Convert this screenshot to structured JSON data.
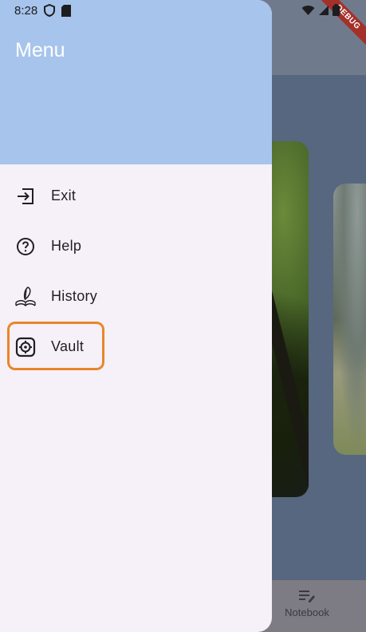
{
  "status_bar": {
    "time": "8:28",
    "left_icons": [
      "shield-icon",
      "sd-card-icon"
    ],
    "right_icons": [
      "wifi-icon",
      "signal-icon",
      "battery-icon"
    ]
  },
  "debug_banner": {
    "label": "DEBUG"
  },
  "drawer": {
    "title": "Menu",
    "header_color": "#a7c4ec",
    "background_color": "#f6f0f8",
    "items": [
      {
        "label": "Exit",
        "icon": "exit-icon"
      },
      {
        "label": "Help",
        "icon": "help-circle-icon"
      },
      {
        "label": "History",
        "icon": "quill-book-icon"
      },
      {
        "label": "Vault",
        "icon": "vault-icon",
        "highlighted": true
      }
    ]
  },
  "bottom_nav": {
    "items": [
      {
        "label": "Notebook",
        "icon": "notebook-icon"
      }
    ]
  },
  "highlight_color": "#e8862a"
}
